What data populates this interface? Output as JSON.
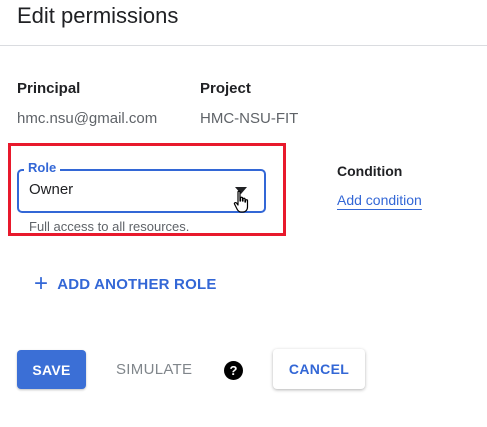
{
  "dialog": {
    "title": "Edit permissions"
  },
  "principal": {
    "label": "Principal",
    "value": "hmc.nsu@gmail.com"
  },
  "project": {
    "label": "Project",
    "value": "HMC-NSU-FIT"
  },
  "role": {
    "label": "Role",
    "selected": "Owner",
    "helper": "Full access to all resources."
  },
  "condition": {
    "label": "Condition",
    "add_link": "Add condition"
  },
  "add_role": {
    "icon": "+",
    "label": "ADD ANOTHER ROLE"
  },
  "actions": {
    "save": "SAVE",
    "simulate": "SIMULATE",
    "help_icon": "?",
    "cancel": "CANCEL"
  },
  "colors": {
    "accent": "#3367d6",
    "highlight": "#e8192c",
    "primary_button": "#3b6fd6"
  }
}
